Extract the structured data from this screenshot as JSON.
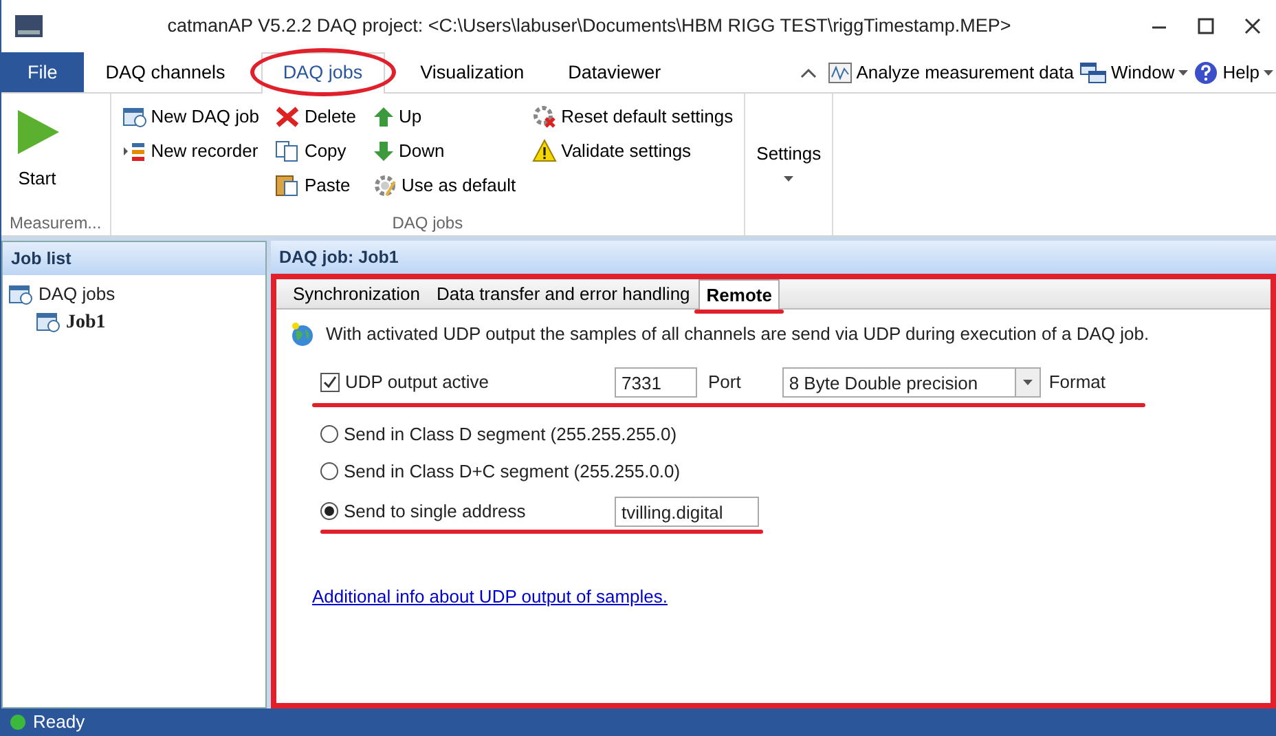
{
  "window": {
    "title": "catmanAP V5.2.2 DAQ project: <C:\\Users\\labuser\\Documents\\HBM RIGG TEST\\riggTimestamp.MEP>"
  },
  "ribbon_tabs": [
    {
      "label": "File",
      "kind": "file"
    },
    {
      "label": "DAQ channels",
      "kind": "tab",
      "selected": false
    },
    {
      "label": "DAQ jobs",
      "kind": "tab",
      "selected": true
    },
    {
      "label": "Visualization",
      "kind": "tab",
      "selected": false
    },
    {
      "label": "Dataviewer",
      "kind": "tab",
      "selected": false
    }
  ],
  "ribbon_right": [
    {
      "label": "Analyze measurement data",
      "kind": "analyze",
      "dropdown": false
    },
    {
      "label": "Window",
      "kind": "window",
      "dropdown": true
    },
    {
      "label": "Help",
      "kind": "help",
      "dropdown": true
    }
  ],
  "ribbon_groups": [
    {
      "label": "Measurem...",
      "columns": [
        [
          {
            "label": "Start",
            "kind": "start"
          }
        ]
      ]
    },
    {
      "label": "DAQ jobs",
      "columns": [
        [
          {
            "label": "New DAQ job",
            "kind": "newjob"
          },
          {
            "label": "New recorder",
            "kind": "recorder"
          }
        ],
        [
          {
            "label": "Delete",
            "kind": "delete"
          },
          {
            "label": "Copy",
            "kind": "copy"
          },
          {
            "label": "Paste",
            "kind": "paste"
          }
        ],
        [
          {
            "label": "Up",
            "kind": "up"
          },
          {
            "label": "Down",
            "kind": "down"
          },
          {
            "label": "Use as default",
            "kind": "gear"
          }
        ],
        [
          {
            "label": "Reset default settings",
            "kind": "reset"
          },
          {
            "label": "Validate settings",
            "kind": "warning"
          }
        ]
      ]
    },
    {
      "label": "Settings"
    }
  ],
  "job_list": {
    "title": "Job list",
    "tree": [
      {
        "label": "DAQ jobs",
        "selected": false,
        "children": [
          {
            "label": "Job1",
            "selected": true
          }
        ]
      }
    ]
  },
  "job_panel": {
    "title": "DAQ job: Job1",
    "tabs": [
      {
        "label": "Synchronization",
        "selected": false
      },
      {
        "label": "Data transfer and error handling",
        "selected": false
      },
      {
        "label": "Remote",
        "selected": true
      }
    ],
    "info": "With activated UDP output the samples of all channels are send via UDP during execution of a DAQ job.",
    "udp_output": {
      "label": "UDP output active",
      "checked": true
    },
    "port": {
      "value": "7331",
      "label": "Port"
    },
    "format": {
      "value": "8 Byte Double precision",
      "label": "Format"
    },
    "targets": [
      {
        "label": "Send in Class D segment (255.255.255.0)",
        "selected": false
      },
      {
        "label": "Send in Class D+C segment (255.255.0.0)",
        "selected": false
      },
      {
        "label": "Send to single address",
        "selected": true,
        "address": "tvilling.digital"
      }
    ],
    "link": "Additional info about UDP output of samples."
  },
  "status_bar": {
    "text": "Ready"
  }
}
